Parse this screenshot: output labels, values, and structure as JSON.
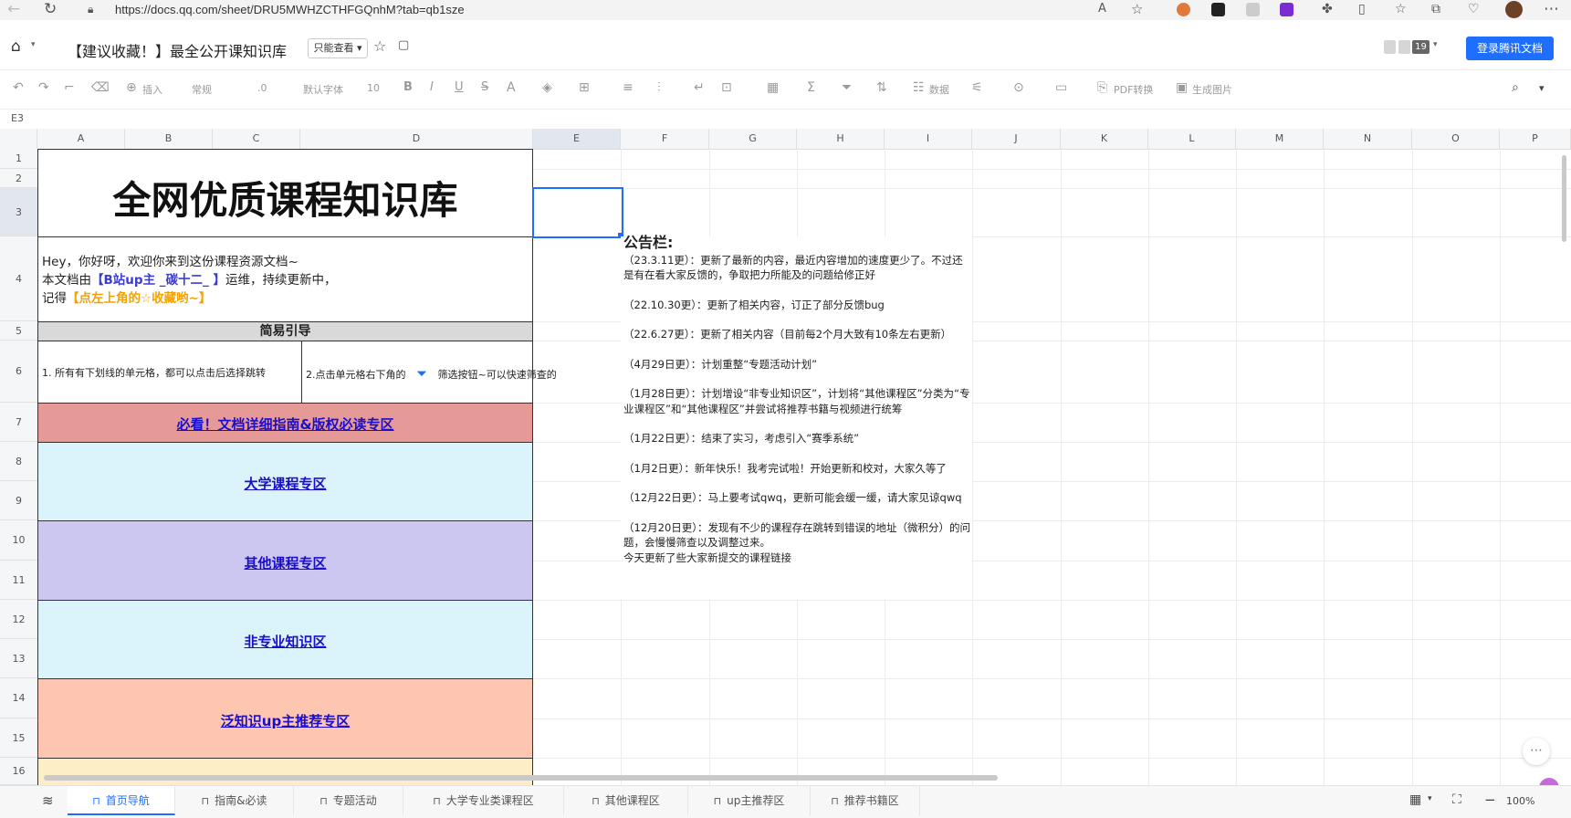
{
  "browser": {
    "url": "https://docs.qq.com/sheet/DRU5MWHZCTHFGQnhM?tab=qb1sze"
  },
  "doc": {
    "title": "【建议收藏！】最全公开课知识库",
    "mode": "只能查看 ▾",
    "collaborator_count": "19",
    "login_button": "登录腾讯文档"
  },
  "toolbar": {
    "insert": "插入",
    "format": "常规",
    "decimal": ".0",
    "font": "默认字体",
    "font_size": "10",
    "bold": "B",
    "italic": "I",
    "underline": "U",
    "strike": "S",
    "data": "数据",
    "pdf": "PDF转换",
    "image": "生成图片"
  },
  "formula": {
    "cell_ref": "E3"
  },
  "columns": [
    "A",
    "B",
    "C",
    "D",
    "E",
    "F",
    "G",
    "H",
    "I",
    "J",
    "K",
    "L",
    "M",
    "N",
    "O",
    "P"
  ],
  "rows": [
    "1",
    "2",
    "3",
    "4",
    "5",
    "6",
    "7",
    "8",
    "9",
    "10",
    "11",
    "12",
    "13",
    "14",
    "15",
    "16"
  ],
  "sheet": {
    "main_title": "全网优质课程知识库",
    "intro_line1": "Hey，你好呀，欢迎你来到这份课程资源文档~",
    "intro_line2_prefix": "本文档由",
    "intro_line2_highlight": "【B站up主 _碳十二_ 】",
    "intro_line2_suffix": "运维，持续更新中，",
    "intro_line3_prefix": "记得",
    "intro_line3_highlight": "【点左上角的☆收藏哟~】",
    "guide_header": "简易引导",
    "guide_1": "1. 所有有下划线的单元格，都可以点击后选择跳转",
    "guide_2_prefix": "2.点击单元格右下角的",
    "guide_2_suffix": "筛选按钮~可以快速筛查的",
    "link_must_read": "必看！文档详细指南&版权必读专区",
    "link_university": "大学课程专区",
    "link_other": "其他课程专区",
    "link_non_major": "非专业知识区",
    "link_up": "泛知识up主推荐专区"
  },
  "notice": {
    "title": "公告栏:",
    "entries": [
      "（23.3.11更）：更新了最新的内容，最近内容增加的速度更少了。不过还是有在看大家反馈的，争取把力所能及的问题给修正好",
      "（22.10.30更）：更新了相关内容，订正了部分反馈bug",
      "（22.6.27更）：更新了相关内容（目前每2个月大致有10条左右更新）",
      "（4月29日更）：计划重整“专题活动计划”",
      "（1月28日更）：计划增设“非专业知识区”，计划将“其他课程区”分类为“专业课程区”和“其他课程区”并尝试将推荐书籍与视频进行统筹",
      "（1月22日更）：结束了实习，考虑引入“赛季系统”",
      "（1月2日更）：新年快乐！我考完试啦！开始更新和校对，大家久等了",
      "（12月22日更）：马上要考试qwq，更新可能会缓一缓，请大家见谅qwq",
      "（12月20日更）：发现有不少的课程存在跳转到错误的地址（微积分）的问题，会慢慢筛查以及调整过来。"
    ],
    "last_line": "今天更新了些大家新提交的课程链接"
  },
  "tabs": [
    "首页导航",
    "指南&必读",
    "专题活动",
    "大学专业类课程区",
    "其他课程区",
    "up主推荐区",
    "推荐书籍区"
  ],
  "status": {
    "zoom": "100%"
  },
  "colors": {
    "accent": "#1e6fff",
    "must_read_bg": "#e69a98",
    "university_bg": "#dbf4fb",
    "other_bg": "#cbc7f1",
    "non_major_bg": "#dbf4fb",
    "up_bg": "#fec5b1",
    "row16_bg": "#fdeec7",
    "highlight_blue": "#3b3bd6",
    "highlight_orange": "#f5a200"
  }
}
